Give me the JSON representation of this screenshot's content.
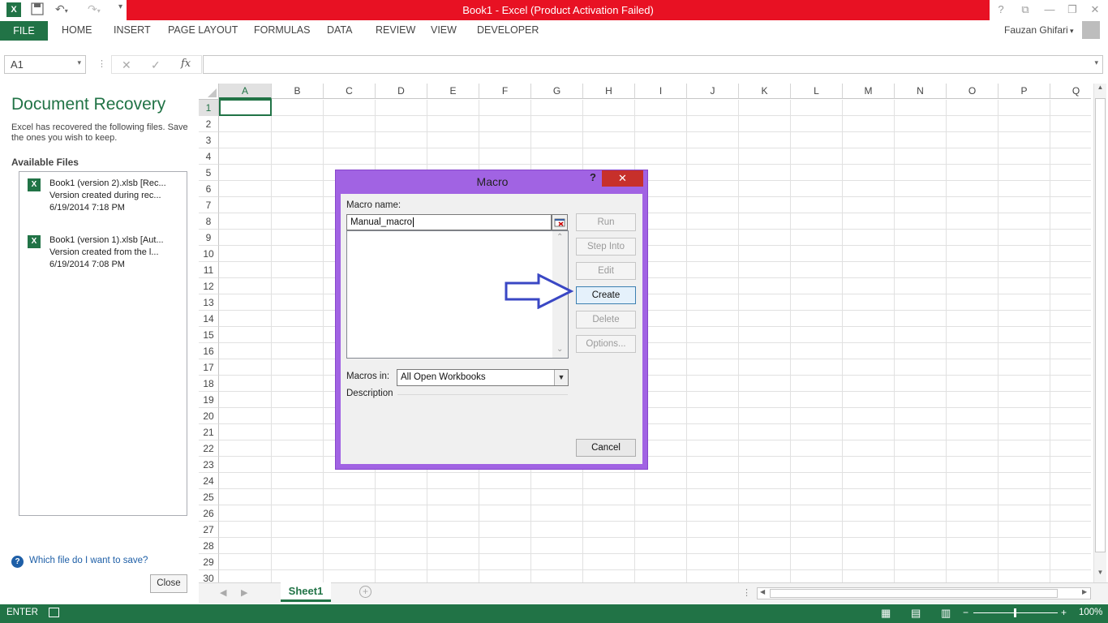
{
  "window": {
    "title": "Book1 -  Excel (Product Activation Failed)",
    "user": "Fauzan Ghifari"
  },
  "ribbon": {
    "tabs": [
      "FILE",
      "HOME",
      "INSERT",
      "PAGE LAYOUT",
      "FORMULAS",
      "DATA",
      "REVIEW",
      "VIEW",
      "DEVELOPER"
    ]
  },
  "formula_bar": {
    "name_box": "A1",
    "fx_label": "fx",
    "value": ""
  },
  "recovery": {
    "title": "Document Recovery",
    "description": "Excel has recovered the following files. Save the ones you wish to keep.",
    "section": "Available Files",
    "files": [
      {
        "name": "Book1 (version 2).xlsb  [Rec...",
        "detail": "Version created during rec...",
        "date": "6/19/2014 7:18 PM"
      },
      {
        "name": "Book1 (version 1).xlsb  [Aut...",
        "detail": "Version created from the l...",
        "date": "6/19/2014 7:08 PM"
      }
    ],
    "help_link": "Which file do I want to save?",
    "close_label": "Close"
  },
  "grid": {
    "columns": [
      "A",
      "B",
      "C",
      "D",
      "E",
      "F",
      "G",
      "H",
      "I",
      "J",
      "K",
      "L",
      "M",
      "N",
      "O",
      "P",
      "Q"
    ],
    "rows": [
      "1",
      "2",
      "3",
      "4",
      "5",
      "6",
      "7",
      "8",
      "9",
      "10",
      "11",
      "12",
      "13",
      "14",
      "15",
      "16",
      "17",
      "18",
      "19",
      "20",
      "21",
      "22",
      "23",
      "24",
      "25",
      "26",
      "27",
      "28",
      "29",
      "30"
    ],
    "active_cell": "A1"
  },
  "sheets": {
    "tabs": [
      "Sheet1"
    ]
  },
  "status": {
    "mode": "ENTER",
    "zoom": "100%"
  },
  "dialog": {
    "title": "Macro",
    "help": "?",
    "macro_name_label": "Macro name:",
    "macro_name_value": "Manual_macro",
    "macros_in_label": "Macros in:",
    "macros_in_value": "All Open Workbooks",
    "description_label": "Description",
    "buttons": {
      "run": "Run",
      "step_into": "Step Into",
      "edit": "Edit",
      "create": "Create",
      "delete": "Delete",
      "options": "Options...",
      "cancel": "Cancel"
    }
  },
  "colors": {
    "excel_green": "#217346",
    "title_red": "#e81123",
    "dialog_purple": "#a163e3",
    "arrow_blue": "#3a47c4"
  }
}
